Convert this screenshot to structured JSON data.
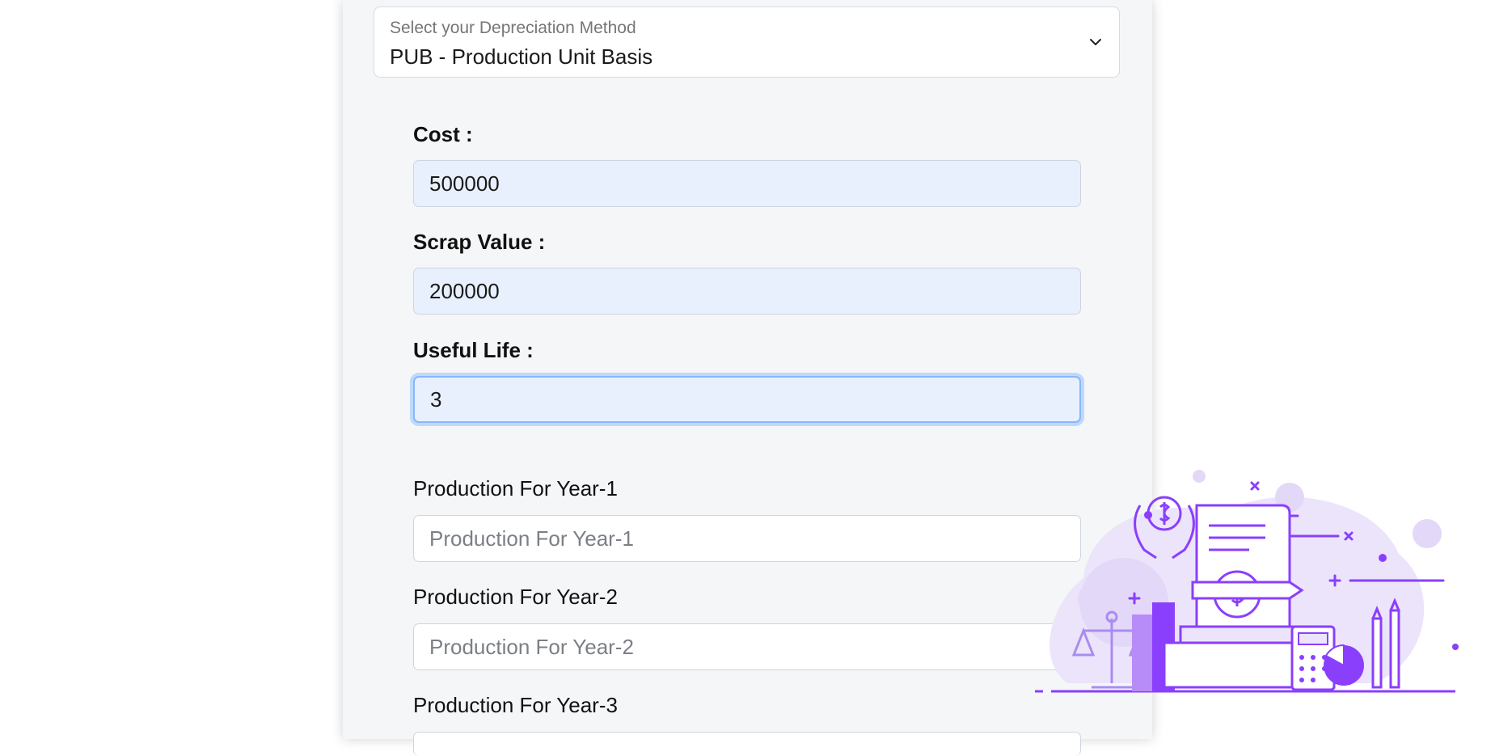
{
  "method_select": {
    "label": "Select your Depreciation Method",
    "value": "PUB - Production Unit Basis",
    "icon": "chevron-down-icon"
  },
  "fields": {
    "cost": {
      "label": "Cost :",
      "value": "500000"
    },
    "scrap_value": {
      "label": "Scrap Value :",
      "value": "200000"
    },
    "useful_life": {
      "label": "Useful Life :",
      "value": "3"
    }
  },
  "production": [
    {
      "label": "Production For Year-1",
      "placeholder": "Production For Year-1",
      "value": ""
    },
    {
      "label": "Production For Year-2",
      "placeholder": "Production For Year-2",
      "value": ""
    },
    {
      "label": "Production For Year-3"
    }
  ],
  "colors": {
    "card_bg": "#f4f6f8",
    "autofill_bg": "#e8f0fe",
    "focus_ring": "#86b7fe",
    "illustration_purple": "#8a3ffc",
    "illustration_light": "#e6dcf8"
  },
  "illustration": {
    "icon": "finance-illustration-icon"
  }
}
